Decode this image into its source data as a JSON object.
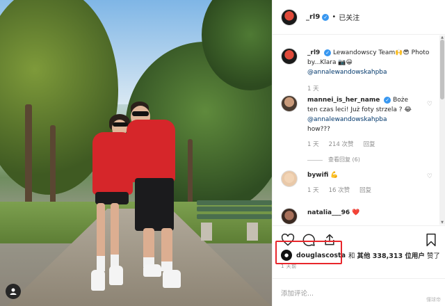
{
  "post_header": {
    "username": "_rl9",
    "separator": "•",
    "follow_status": "已关注"
  },
  "comments": [
    {
      "username": "_rl9",
      "text": "Lewandowscy Team🙌😎 Photo by...Klara 📷😀",
      "mention": "@annalewandowskahpba",
      "time": "1 天"
    },
    {
      "username": "mannei_is_her_name",
      "text": "Boże ten czas leci! Już foty strzela ? 😂",
      "mention": "@annalewandowskahpba",
      "text_after": "how???",
      "time": "1 天",
      "likes": "214 次赞",
      "reply": "回复",
      "view_replies": "查看回复 (6)"
    },
    {
      "username": "bywifi",
      "text": "💪",
      "time": "1 天",
      "likes": "16 次赞",
      "reply": "回复"
    },
    {
      "username": "natalia___96",
      "text": "❤️"
    }
  ],
  "likes_line": {
    "liker": "douglascosta",
    "connector": "和",
    "others": "其他 338,313 位用户",
    "suffix": "赞了"
  },
  "timestamp": "1 天前",
  "add_comment_placeholder": "添加评论...",
  "watermark": "懂球帝",
  "icons": {
    "like": "heart-outline-icon",
    "comment": "comment-bubble-icon",
    "share": "share-icon",
    "save": "bookmark-icon",
    "comment_like": "small-heart-icon",
    "verified": "verified-badge-icon"
  },
  "colors": {
    "highlight_box": "#e8262b",
    "verified": "#3897f0",
    "mention": "#00376b",
    "hoodie": "#d6262a"
  }
}
